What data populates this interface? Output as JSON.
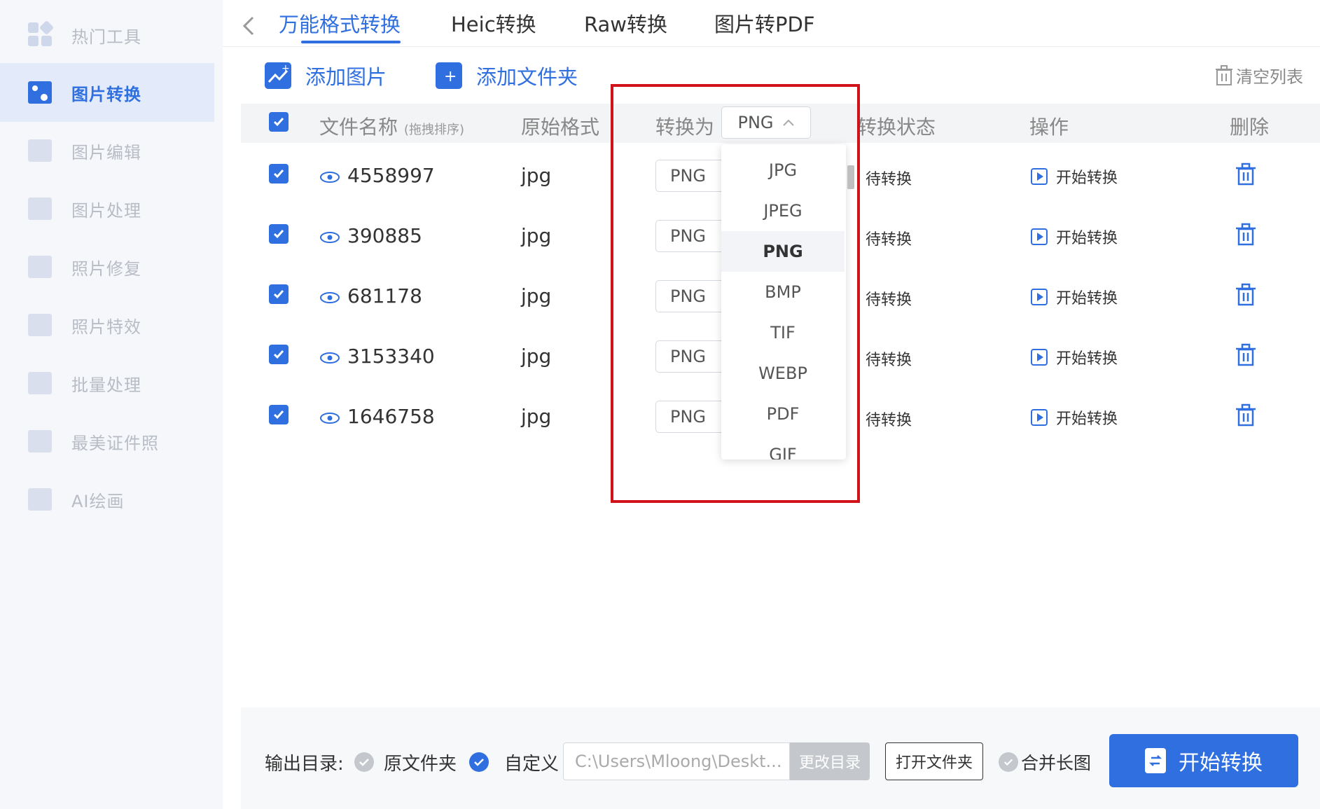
{
  "sidebar": {
    "items": [
      {
        "label": "热门工具",
        "icon": "grid-icon"
      },
      {
        "label": "图片转换",
        "icon": "image-convert-icon"
      },
      {
        "label": "图片编辑",
        "icon": "image-edit-icon"
      },
      {
        "label": "图片处理",
        "icon": "image-process-icon"
      },
      {
        "label": "照片修复",
        "icon": "photo-repair-icon"
      },
      {
        "label": "照片特效",
        "icon": "photo-effect-icon"
      },
      {
        "label": "批量处理",
        "icon": "batch-icon"
      },
      {
        "label": "最美证件照",
        "icon": "id-photo-icon"
      },
      {
        "label": "AI绘画",
        "icon": "ai-paint-icon"
      }
    ],
    "active_index": 1
  },
  "tabs": [
    "万能格式转换",
    "Heic转换",
    "Raw转换",
    "图片转PDF"
  ],
  "toolbar": {
    "add_image": "添加图片",
    "add_folder": "添加文件夹",
    "clear_list": "清空列表"
  },
  "table": {
    "headers": {
      "filename": "文件名称",
      "filename_hint": "(拖拽排序)",
      "original_format": "原始格式",
      "convert_to": "转换为",
      "status": "转换状态",
      "action": "操作",
      "delete": "删除"
    },
    "head_select_value": "PNG",
    "rows": [
      {
        "name": "4558997",
        "format": "jpg",
        "target": "PNG",
        "status": "待转换",
        "action": "开始转换"
      },
      {
        "name": "390885",
        "format": "jpg",
        "target": "PNG",
        "status": "待转换",
        "action": "开始转换"
      },
      {
        "name": "681178",
        "format": "jpg",
        "target": "PNG",
        "status": "待转换",
        "action": "开始转换"
      },
      {
        "name": "3153340",
        "format": "jpg",
        "target": "PNG",
        "status": "待转换",
        "action": "开始转换"
      },
      {
        "name": "1646758",
        "format": "jpg",
        "target": "PNG",
        "status": "待转换",
        "action": "开始转换"
      }
    ]
  },
  "dropdown": {
    "options": [
      "JPG",
      "JPEG",
      "PNG",
      "BMP",
      "TIF",
      "WEBP",
      "PDF",
      "GIF"
    ],
    "selected": "PNG"
  },
  "bottom": {
    "output_label": "输出目录:",
    "option_original": "原文件夹",
    "option_custom": "自定义",
    "path": "C:\\Users\\Mloong\\Deskt...",
    "change_dir": "更改目录",
    "open_folder": "打开文件夹",
    "merge": "合并长图",
    "start": "开始转换"
  },
  "colors": {
    "accent": "#2f6fe0",
    "highlight_border": "#d0121b"
  }
}
